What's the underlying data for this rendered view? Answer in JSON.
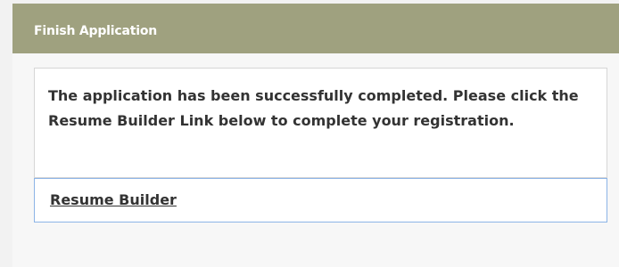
{
  "panel": {
    "title": "Finish Application",
    "message": "The application has been successfully completed. Please click the Resume Builder Link below to complete your registration.",
    "link_label": "Resume Builder"
  },
  "colors": {
    "header_bg": "#9fa17f",
    "header_text": "#ffffff",
    "body_text": "#333333",
    "link_box_border": "#8cb4e6"
  }
}
